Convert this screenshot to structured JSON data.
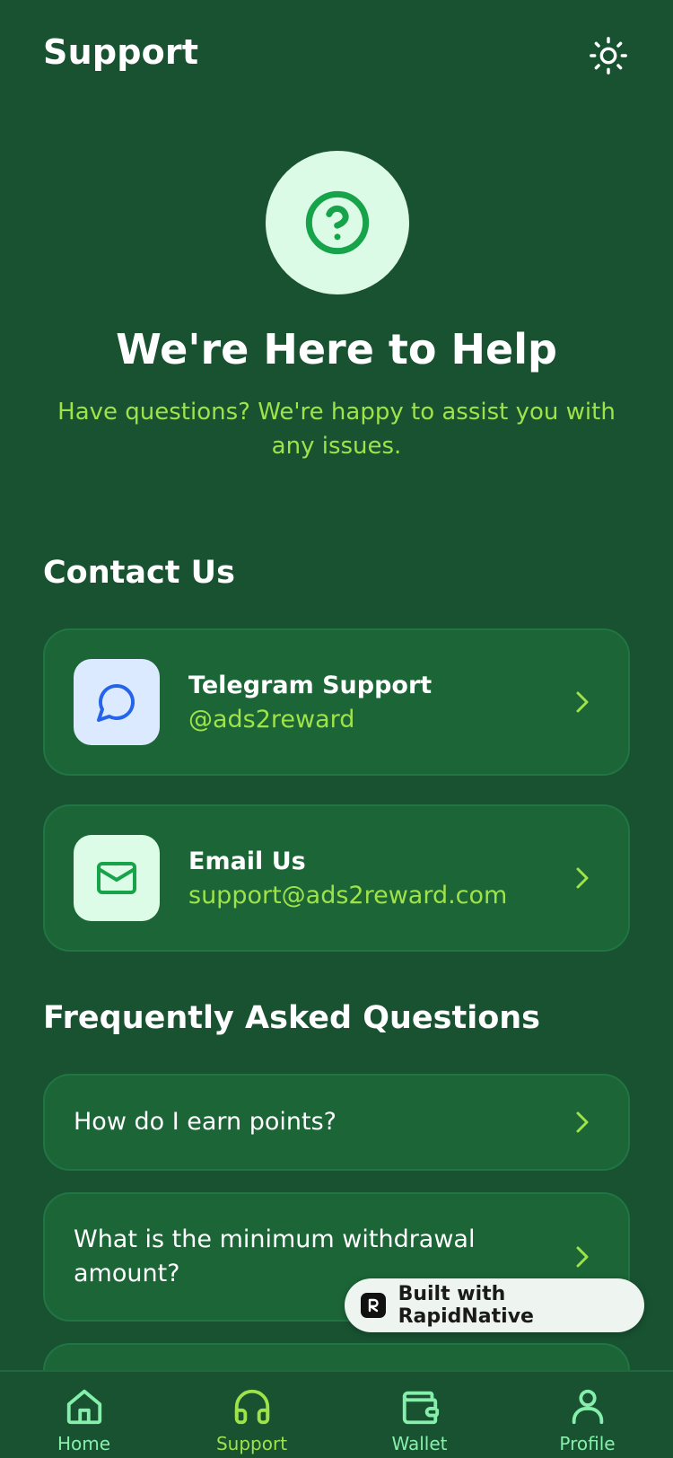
{
  "header": {
    "title": "Support"
  },
  "hero": {
    "title": "We're Here to Help",
    "subtitle": "Have questions? We're happy to assist you with any issues."
  },
  "contact": {
    "section_title": "Contact Us",
    "items": [
      {
        "name": "Telegram Support",
        "value": "@ads2reward",
        "icon": "chat-bubble-icon"
      },
      {
        "name": "Email Us",
        "value": "support@ads2reward.com",
        "icon": "mail-icon"
      }
    ]
  },
  "faq": {
    "section_title": "Frequently Asked Questions",
    "items": [
      {
        "question": "How do I earn points?"
      },
      {
        "question": "What is the minimum withdrawal amount?"
      }
    ]
  },
  "badge": {
    "label": "Built with RapidNative"
  },
  "tabbar": {
    "tabs": [
      {
        "label": "Home",
        "icon": "home-icon"
      },
      {
        "label": "Support",
        "icon": "headphones-icon",
        "active": true
      },
      {
        "label": "Wallet",
        "icon": "wallet-icon"
      },
      {
        "label": "Profile",
        "icon": "user-icon"
      }
    ]
  },
  "colors": {
    "background": "#185231",
    "card": "#1b6537",
    "accent": "#9fe34a",
    "hero_circle": "#dcfbe7",
    "tab_inactive": "#86efac"
  }
}
